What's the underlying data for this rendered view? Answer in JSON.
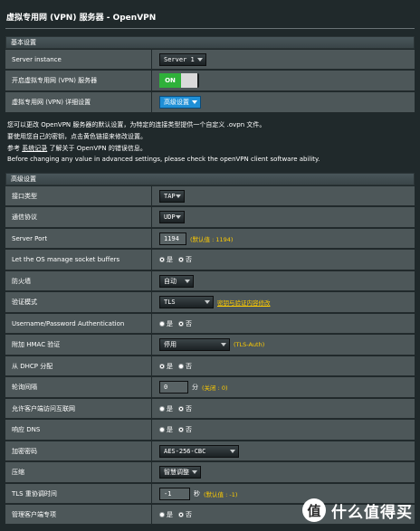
{
  "page_title": "虚拟专用网 (VPN) 服务器 - OpenVPN",
  "basic": {
    "header": "基本设置",
    "server_instance_label": "Server instance",
    "server_instance_value": "Server 1",
    "enable_label": "开启虚拟专用网 (VPN) 服务器",
    "enable_value": "ON",
    "detail_label": "虚拟专用网 (VPN) 详细设置",
    "detail_value": "高级设置"
  },
  "info": {
    "line1": "您可以更改 OpenVPN 服务器的默认设置，为特定的连接类型提供一个自定义 .ovpn 文件。",
    "line2": "要使用您自己的密钥，点击黄色链接来修改设置。",
    "line3_pre": "参考",
    "line3_link": "系统记录",
    "line3_post": "了解关于 OpenVPN 的错误信息。",
    "line4": "Before changing any value in advanced settings, please check the openVPN client software ability."
  },
  "advanced": {
    "header": "高级设置",
    "interface_label": "接口类型",
    "interface_value": "TAP",
    "protocol_label": "通信协议",
    "protocol_value": "UDP",
    "port_label": "Server Port",
    "port_value": "1194",
    "port_hint": "(默认值 : 1194)",
    "buffers_label": "Let the OS manage socket buffers",
    "firewall_label": "防火墙",
    "firewall_value": "自动",
    "auth_mode_label": "验证模式",
    "auth_mode_value": "TLS",
    "auth_mode_link": "密钥与验证内容修改",
    "userpass_label": "Username/Password Authentication",
    "hmac_label": "附加 HMAC 验证",
    "hmac_value": "停用",
    "hmac_hint": "(TLS-Auth)",
    "dhcp_label": "从 DHCP 分配",
    "poll_label": "轮询间隔",
    "poll_value": "0",
    "poll_unit": "分",
    "poll_hint": "(关闭 : 0)",
    "client_internet_label": "允许客户端访问互联网",
    "dns_label": "响应 DNS",
    "cipher_label": "加密密码",
    "cipher_value": "AES-256-CBC",
    "compress_label": "压缩",
    "compress_value": "智慧调整",
    "tls_reneg_label": "TLS 重协调时间",
    "tls_reneg_value": "-1",
    "tls_reneg_unit": "秒",
    "tls_reneg_hint": "(默认值 : -1)",
    "manage_client_label": "管理客户端专项"
  },
  "radio": {
    "yes": "是",
    "no": "否"
  },
  "watermark": {
    "logo": "值",
    "text": "什么值得买"
  }
}
